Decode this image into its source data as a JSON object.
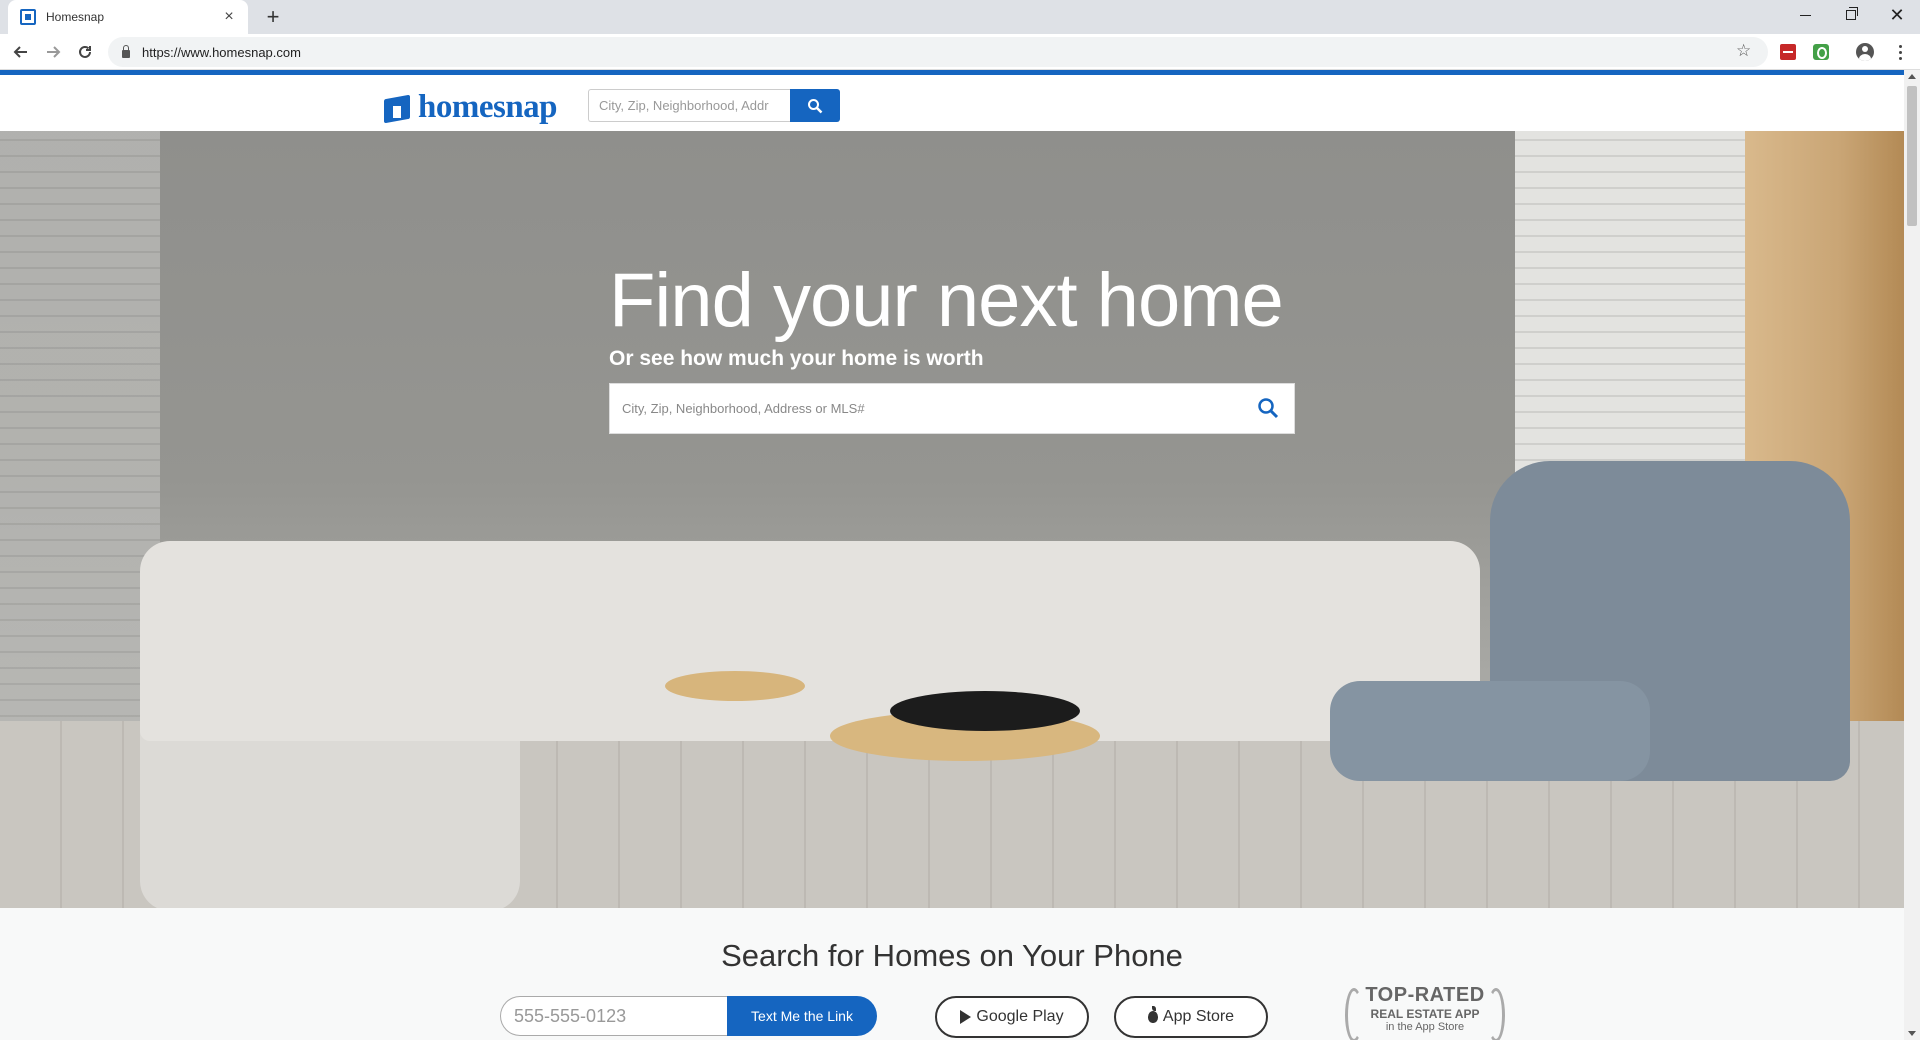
{
  "browser": {
    "tab_title": "Homesnap",
    "tab_close": "×",
    "new_tab": "+",
    "url": "https://www.homesnap.com"
  },
  "header": {
    "logo_text": "homesnap",
    "search_placeholder": "City, Zip, Neighborhood, Addr"
  },
  "hero": {
    "title": "Find your next home",
    "subtitle": "Or see how much your home is worth",
    "search_placeholder": "City, Zip, Neighborhood, Address or MLS#"
  },
  "app_section": {
    "title": "Search for Homes on Your Phone",
    "phone_placeholder": "555-555-0123",
    "text_link_label": "Text Me the Link",
    "google_play_label": "Google Play",
    "app_store_label": "App Store",
    "badge": {
      "line1": "TOP-RATED",
      "line2": "REAL ESTATE APP",
      "line3": "in the App Store"
    }
  },
  "colors": {
    "brand_blue": "#1565c0",
    "chrome_bg": "#dee1e6"
  },
  "icons": [
    "tab-favicon-icon",
    "back-arrow-icon",
    "forward-arrow-icon",
    "reload-icon",
    "lock-icon",
    "star-icon",
    "extension-icon",
    "profile-icon",
    "menu-icon",
    "search-icon",
    "play-icon",
    "apple-icon"
  ]
}
